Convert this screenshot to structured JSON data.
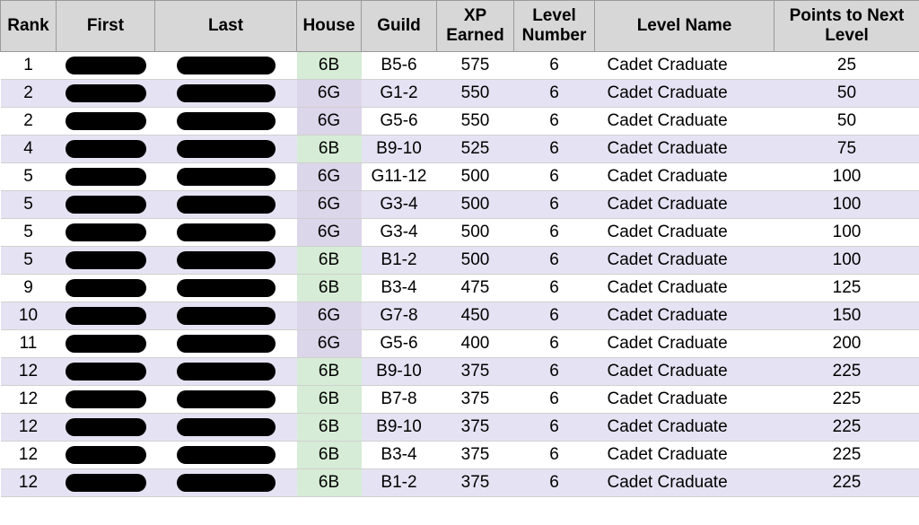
{
  "headers": {
    "rank": "Rank",
    "first": "First",
    "last": "Last",
    "house": "House",
    "guild": "Guild",
    "xp": "XP Earned",
    "level_num": "Level Number",
    "level_name": "Level Name",
    "points_next": "Points to Next Level"
  },
  "house_colors": {
    "6B": "#d6ecd6",
    "6G": "#dcd6ea"
  },
  "rows": [
    {
      "rank": 1,
      "house": "6B",
      "guild": "B5-6",
      "xp": 575,
      "level_num": 6,
      "level_name": "Cadet Craduate",
      "points_next": 25
    },
    {
      "rank": 2,
      "house": "6G",
      "guild": "G1-2",
      "xp": 550,
      "level_num": 6,
      "level_name": "Cadet Craduate",
      "points_next": 50
    },
    {
      "rank": 2,
      "house": "6G",
      "guild": "G5-6",
      "xp": 550,
      "level_num": 6,
      "level_name": "Cadet Craduate",
      "points_next": 50
    },
    {
      "rank": 4,
      "house": "6B",
      "guild": "B9-10",
      "xp": 525,
      "level_num": 6,
      "level_name": "Cadet Craduate",
      "points_next": 75
    },
    {
      "rank": 5,
      "house": "6G",
      "guild": "G11-12",
      "xp": 500,
      "level_num": 6,
      "level_name": "Cadet Craduate",
      "points_next": 100
    },
    {
      "rank": 5,
      "house": "6G",
      "guild": "G3-4",
      "xp": 500,
      "level_num": 6,
      "level_name": "Cadet Craduate",
      "points_next": 100
    },
    {
      "rank": 5,
      "house": "6G",
      "guild": "G3-4",
      "xp": 500,
      "level_num": 6,
      "level_name": "Cadet Craduate",
      "points_next": 100
    },
    {
      "rank": 5,
      "house": "6B",
      "guild": "B1-2",
      "xp": 500,
      "level_num": 6,
      "level_name": "Cadet Craduate",
      "points_next": 100
    },
    {
      "rank": 9,
      "house": "6B",
      "guild": "B3-4",
      "xp": 475,
      "level_num": 6,
      "level_name": "Cadet Craduate",
      "points_next": 125
    },
    {
      "rank": 10,
      "house": "6G",
      "guild": "G7-8",
      "xp": 450,
      "level_num": 6,
      "level_name": "Cadet Craduate",
      "points_next": 150
    },
    {
      "rank": 11,
      "house": "6G",
      "guild": "G5-6",
      "xp": 400,
      "level_num": 6,
      "level_name": "Cadet Craduate",
      "points_next": 200
    },
    {
      "rank": 12,
      "house": "6B",
      "guild": "B9-10",
      "xp": 375,
      "level_num": 6,
      "level_name": "Cadet Craduate",
      "points_next": 225
    },
    {
      "rank": 12,
      "house": "6B",
      "guild": "B7-8",
      "xp": 375,
      "level_num": 6,
      "level_name": "Cadet Craduate",
      "points_next": 225
    },
    {
      "rank": 12,
      "house": "6B",
      "guild": "B9-10",
      "xp": 375,
      "level_num": 6,
      "level_name": "Cadet Craduate",
      "points_next": 225
    },
    {
      "rank": 12,
      "house": "6B",
      "guild": "B3-4",
      "xp": 375,
      "level_num": 6,
      "level_name": "Cadet Craduate",
      "points_next": 225
    },
    {
      "rank": 12,
      "house": "6B",
      "guild": "B1-2",
      "xp": 375,
      "level_num": 6,
      "level_name": "Cadet Craduate",
      "points_next": 225
    }
  ]
}
